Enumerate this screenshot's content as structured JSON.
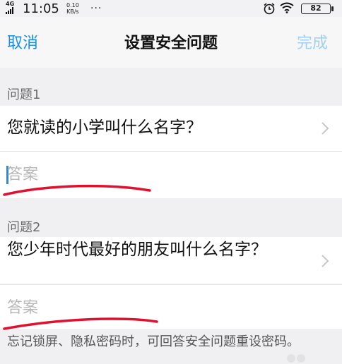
{
  "status_bar": {
    "network": "4G",
    "time": "11:05",
    "speed_value": "0.10",
    "speed_unit": "KB/s",
    "more": "···",
    "battery": "82"
  },
  "nav": {
    "cancel_label": "取消",
    "title": "设置安全问题",
    "done_label": "完成"
  },
  "questions": [
    {
      "label": "问题1",
      "text": "您就读的小学叫什么名字？",
      "answer_placeholder": "答案"
    },
    {
      "label": "问题2",
      "text": "您少年时代最好的朋友叫什么名字？",
      "answer_placeholder": "答案"
    }
  ],
  "hint": "忘记锁屏、隐私密码时，可回答安全问题重设密码。",
  "colors": {
    "accent": "#1a8fe6",
    "done_disabled": "#9fd0f2",
    "annotation_red": "#e0102e"
  }
}
